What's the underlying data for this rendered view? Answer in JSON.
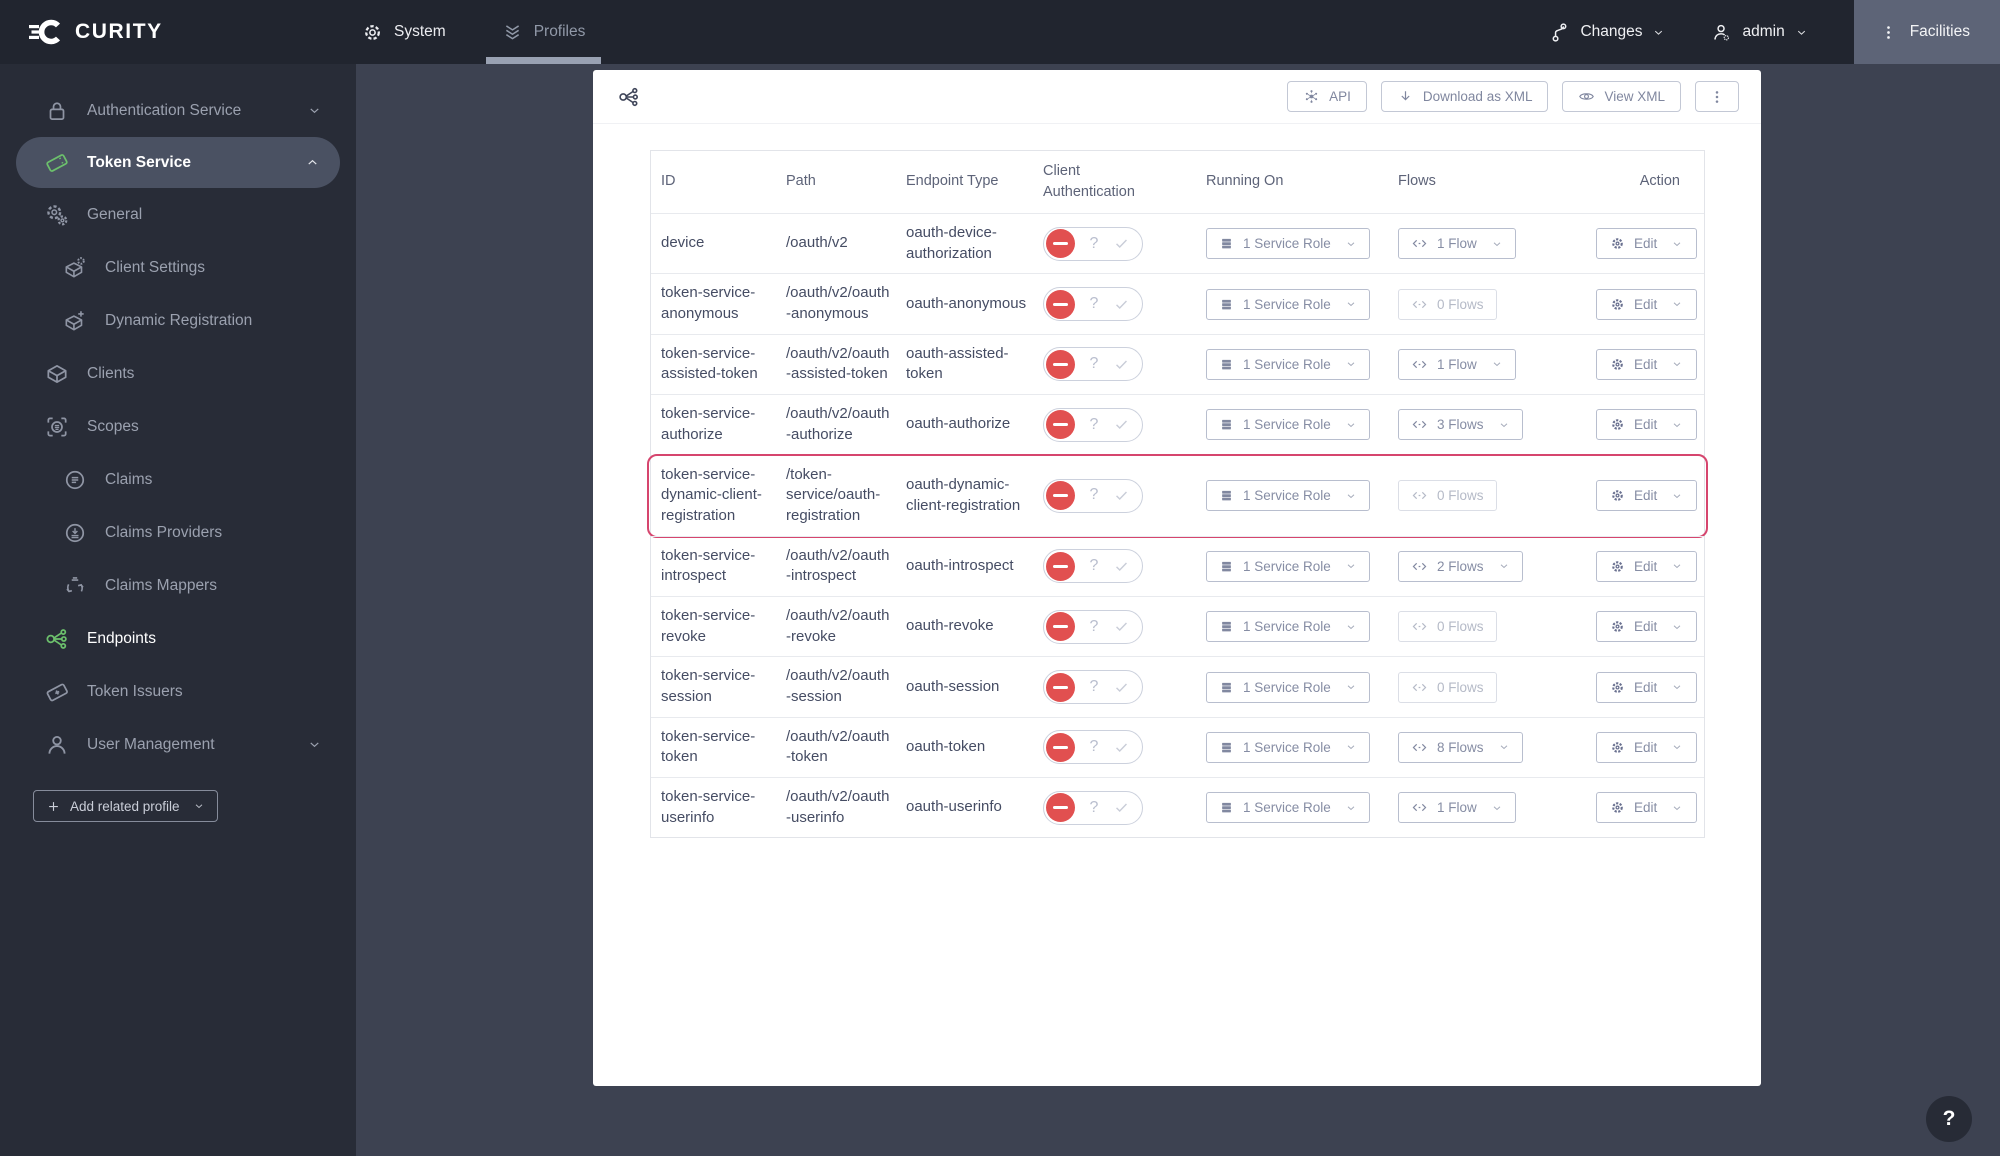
{
  "colors": {
    "brand_green": "#6cc06c",
    "danger_red": "#e15050",
    "highlight_border": "#d6456e",
    "topnav_bg": "#21252f",
    "sidebar_bg": "#282c37",
    "main_bg": "#3d4251",
    "facilities_bg": "#5d6477"
  },
  "topnav": {
    "brand": "CURITY",
    "tabs": [
      {
        "label": "System",
        "icon": "gear",
        "active": false
      },
      {
        "label": "Profiles",
        "icon": "profiles",
        "active": true
      }
    ],
    "right": {
      "changes": {
        "label": "Changes",
        "icon": "branch"
      },
      "admin": {
        "label": "admin",
        "icon": "user-gear"
      },
      "facilities": {
        "label": "Facilities",
        "icon": "dots-vertical"
      }
    }
  },
  "sidebar": {
    "items": [
      {
        "label": "Authentication Service",
        "icon": "lock",
        "chevron": "down",
        "indent": 0
      },
      {
        "label": "Token Service",
        "icon": "ticket",
        "chevron": "up",
        "indent": 0,
        "active": true,
        "icon_color": "#6cc06c"
      },
      {
        "label": "General",
        "icon": "gears",
        "indent": 1
      },
      {
        "label": "Client Settings",
        "icon": "box-gear",
        "indent": 2
      },
      {
        "label": "Dynamic Registration",
        "icon": "box-plus",
        "indent": 2
      },
      {
        "label": "Clients",
        "icon": "box",
        "indent": 1
      },
      {
        "label": "Scopes",
        "icon": "scope",
        "indent": 1
      },
      {
        "label": "Claims",
        "icon": "claims",
        "indent": 2
      },
      {
        "label": "Claims Providers",
        "icon": "claims-providers",
        "indent": 2
      },
      {
        "label": "Claims Mappers",
        "icon": "claims-mappers",
        "indent": 2
      },
      {
        "label": "Endpoints",
        "icon": "endpoints",
        "indent": 1,
        "selected": true,
        "icon_color": "#6cc06c"
      },
      {
        "label": "Token Issuers",
        "icon": "ticket-plus",
        "indent": 1
      },
      {
        "label": "User Management",
        "icon": "user",
        "chevron": "down",
        "indent": 0
      }
    ],
    "add_related_profile_label": "Add related profile"
  },
  "content": {
    "toolbar": {
      "api_label": "API",
      "download_label": "Download as XML",
      "view_label": "View XML"
    },
    "help_label": "?"
  },
  "table": {
    "columns": [
      "ID",
      "Path",
      "Endpoint Type",
      "Client Authentication",
      "Running On",
      "Flows",
      "Action"
    ],
    "edit_label": "Edit",
    "toggle": {
      "optional_label": "?"
    },
    "rows": [
      {
        "id": "device",
        "path": "/oauth/v2",
        "type": "oauth-device-authorization",
        "running_on": "1 Service Role",
        "flows": "1 Flow",
        "flows_enabled": true,
        "highlighted": false
      },
      {
        "id": "token-service-anonymous",
        "path": "/oauth/v2/oauth-anonymous",
        "type": "oauth-anonymous",
        "running_on": "1 Service Role",
        "flows": "0 Flows",
        "flows_enabled": false,
        "highlighted": false
      },
      {
        "id": "token-service-assisted-token",
        "path": "/oauth/v2/oauth-assisted-token",
        "type": "oauth-assisted-token",
        "running_on": "1 Service Role",
        "flows": "1 Flow",
        "flows_enabled": true,
        "highlighted": false
      },
      {
        "id": "token-service-authorize",
        "path": "/oauth/v2/oauth-authorize",
        "type": "oauth-authorize",
        "running_on": "1 Service Role",
        "flows": "3 Flows",
        "flows_enabled": true,
        "highlighted": false
      },
      {
        "id": "token-service-dynamic-client-registration",
        "path": "/token-service/oauth-registration",
        "type": "oauth-dynamic-client-registration",
        "running_on": "1 Service Role",
        "flows": "0 Flows",
        "flows_enabled": false,
        "highlighted": true
      },
      {
        "id": "token-service-introspect",
        "path": "/oauth/v2/oauth-introspect",
        "type": "oauth-introspect",
        "running_on": "1 Service Role",
        "flows": "2 Flows",
        "flows_enabled": true,
        "highlighted": false
      },
      {
        "id": "token-service-revoke",
        "path": "/oauth/v2/oauth-revoke",
        "type": "oauth-revoke",
        "running_on": "1 Service Role",
        "flows": "0 Flows",
        "flows_enabled": false,
        "highlighted": false
      },
      {
        "id": "token-service-session",
        "path": "/oauth/v2/oauth-session",
        "type": "oauth-session",
        "running_on": "1 Service Role",
        "flows": "0 Flows",
        "flows_enabled": false,
        "highlighted": false
      },
      {
        "id": "token-service-token",
        "path": "/oauth/v2/oauth-token",
        "type": "oauth-token",
        "running_on": "1 Service Role",
        "flows": "8 Flows",
        "flows_enabled": true,
        "highlighted": false
      },
      {
        "id": "token-service-userinfo",
        "path": "/oauth/v2/oauth-userinfo",
        "type": "oauth-userinfo",
        "running_on": "1 Service Role",
        "flows": "1 Flow",
        "flows_enabled": true,
        "highlighted": false
      }
    ]
  }
}
